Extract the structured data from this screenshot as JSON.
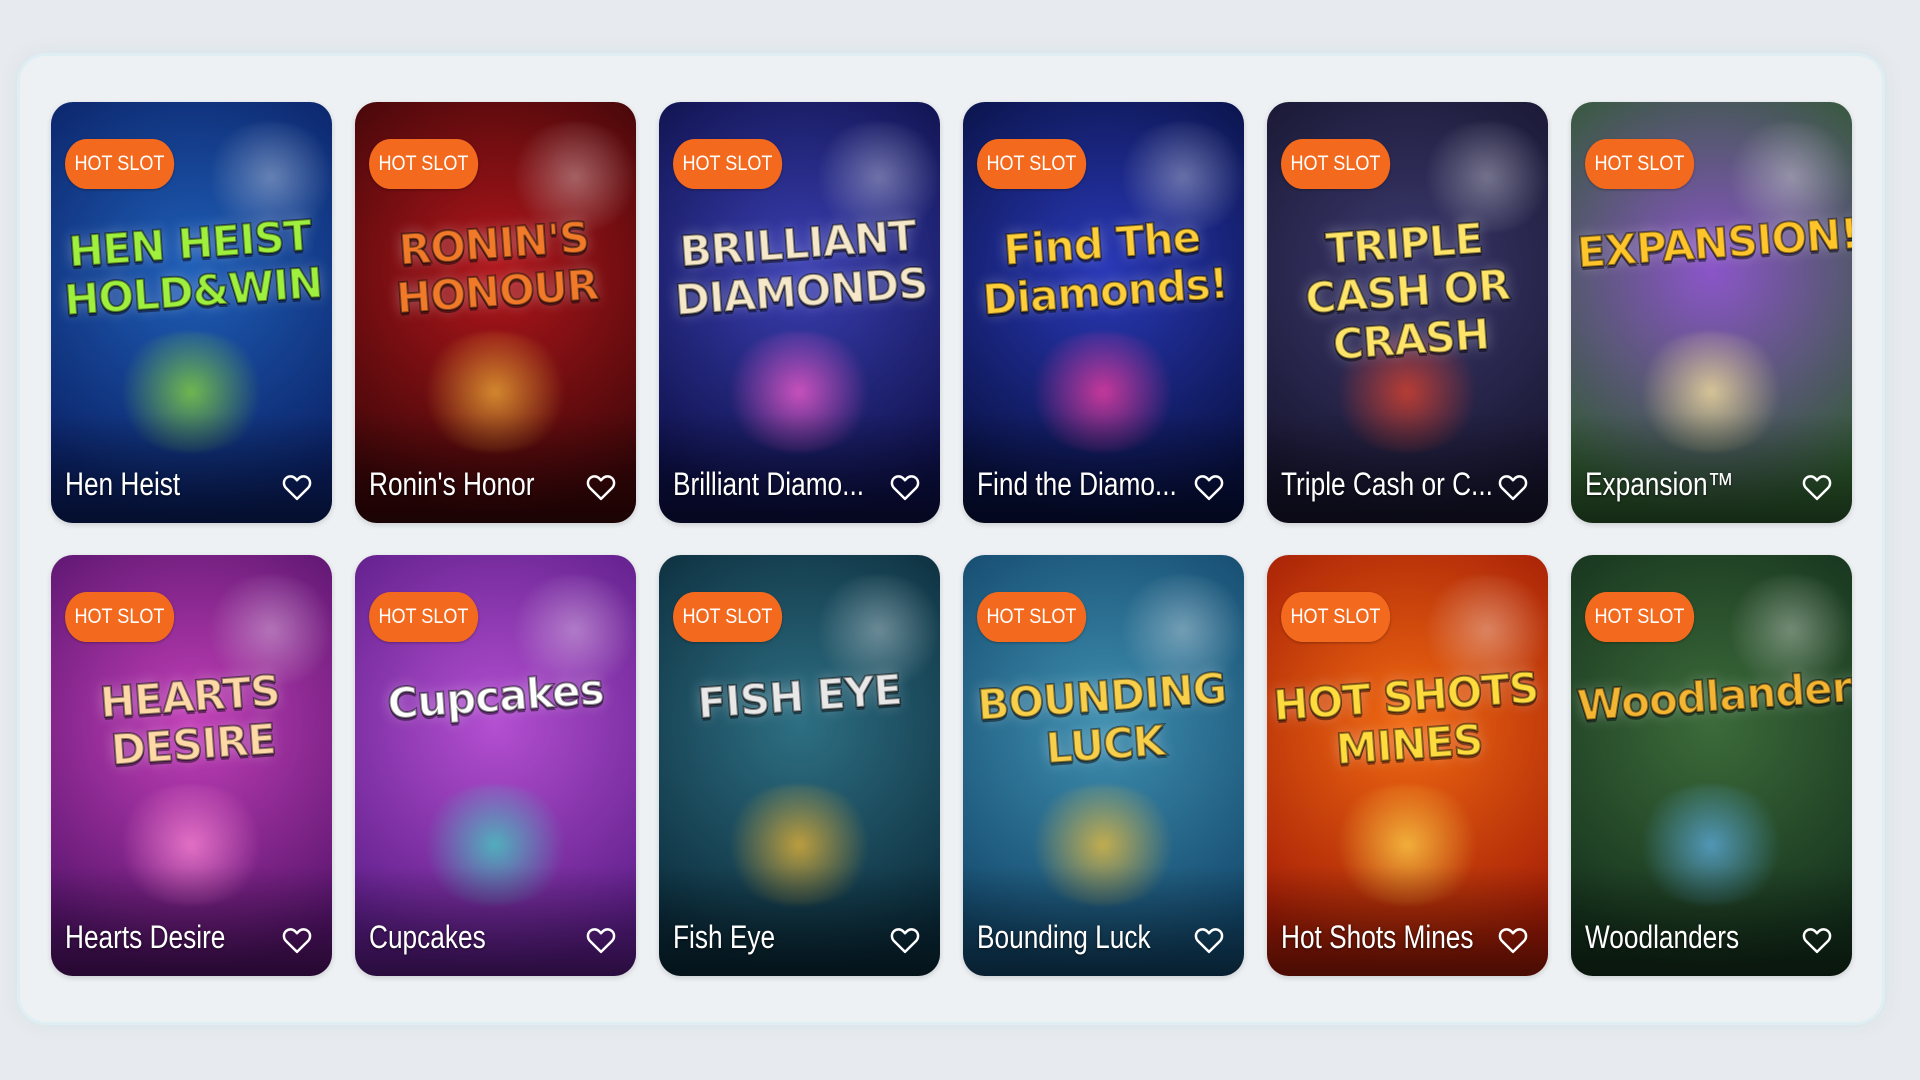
{
  "games": [
    {
      "name": "Hen Heist",
      "badge": "HOT SLOT",
      "art_text": "HEN HEIST\nHOLD&WIN",
      "bg1": "#1f5fb8",
      "bg2": "#0a1f63",
      "accent": "#8ee03a",
      "title_color": "#9ff03e"
    },
    {
      "name": "Ronin's Honor",
      "badge": "HOT SLOT",
      "art_text": "RONIN'S\nHONOUR",
      "bg1": "#b0161b",
      "bg2": "#3b0608",
      "accent": "#f2b138",
      "title_color": "#f07a2a"
    },
    {
      "name": "Brilliant Diamo...",
      "badge": "HOT SLOT",
      "art_text": "BRILLIANT\nDIAMONDS",
      "bg1": "#3b3fb3",
      "bg2": "#0c0f45",
      "accent": "#ff5fd2",
      "title_color": "#f5e7c9"
    },
    {
      "name": "Find the Diamo...",
      "badge": "HOT SLOT",
      "art_text": "Find The\nDiamonds!",
      "bg1": "#2a39b8",
      "bg2": "#07103f",
      "accent": "#ff3fa5",
      "title_color": "#ffcf3b"
    },
    {
      "name": "Triple Cash or C...",
      "badge": "HOT SLOT",
      "art_text": "TRIPLE\nCASH OR\nCRASH",
      "bg1": "#3c3a6f",
      "bg2": "#17152e",
      "accent": "#e8442c",
      "title_color": "#ffe46a"
    },
    {
      "name": "Expansion™",
      "badge": "HOT SLOT",
      "art_text": "EXPANSION!",
      "bg1": "#8b55c9",
      "bg2": "#2d5a2d",
      "accent": "#ffe9a0",
      "title_color": "#ffc52b"
    },
    {
      "name": "Hearts Desire",
      "badge": "HOT SLOT",
      "art_text": "HEARTS\nDESIRE",
      "bg1": "#c23fb7",
      "bg2": "#54136b",
      "accent": "#ff88d6",
      "title_color": "#ffd8a8"
    },
    {
      "name": "Cupcakes",
      "badge": "HOT SLOT",
      "art_text": "Cupcakes",
      "bg1": "#b44fd1",
      "bg2": "#5a1c86",
      "accent": "#3fd7c2",
      "title_color": "#ffffff"
    },
    {
      "name": "Fish Eye",
      "badge": "HOT SLOT",
      "art_text": "FISH EYE",
      "bg1": "#2e6f83",
      "bg2": "#0a2a39",
      "accent": "#f2b933",
      "title_color": "#e8e8e8"
    },
    {
      "name": "Bounding Luck",
      "badge": "HOT SLOT",
      "art_text": "BOUNDING\nLUCK",
      "bg1": "#3f8fb0",
      "bg2": "#12466a",
      "accent": "#f5c33b",
      "title_color": "#f7cf4a"
    },
    {
      "name": "Hot Shots Mines",
      "badge": "HOT SLOT",
      "art_text": "HOT SHOTS\nMINES",
      "bg1": "#f06a12",
      "bg2": "#a11a06",
      "accent": "#ffd44a",
      "title_color": "#ffdb3d"
    },
    {
      "name": "Woodlanders",
      "badge": "HOT SLOT",
      "art_text": "Woodlanders",
      "bg1": "#3c6b3a",
      "bg2": "#14301c",
      "accent": "#5fb0e6",
      "title_color": "#f4b533"
    }
  ]
}
